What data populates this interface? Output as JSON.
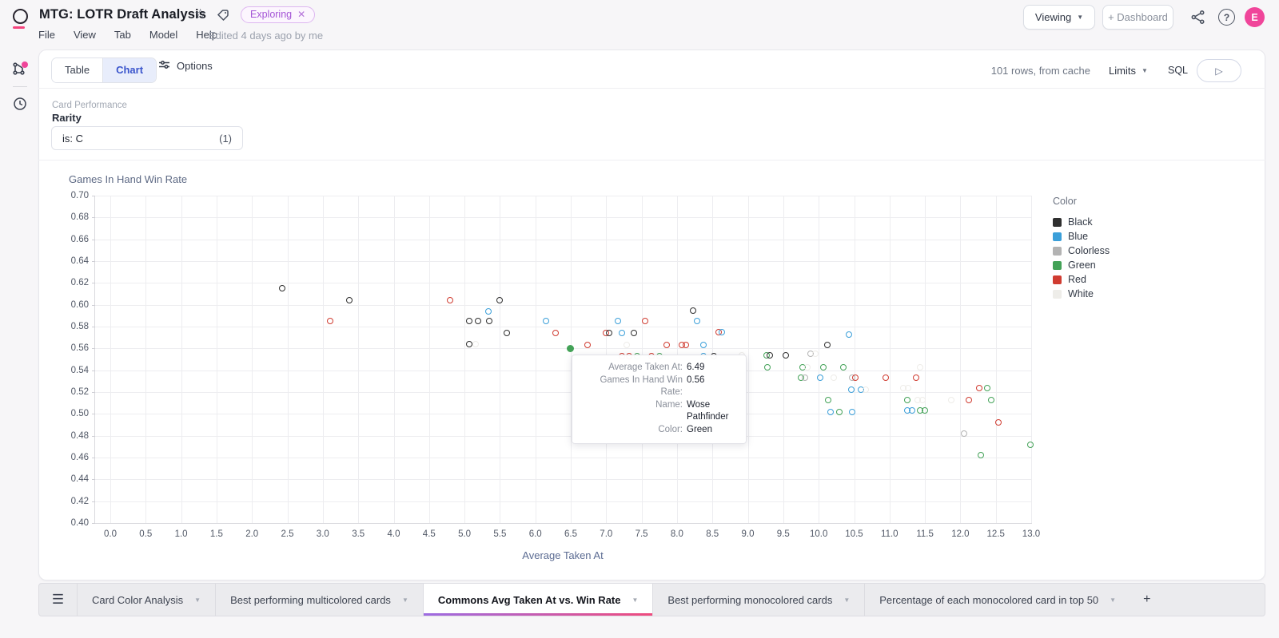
{
  "header": {
    "title": "MTG: LOTR Draft Analysis",
    "badge": "Exploring",
    "badge_close": "✕",
    "menu": [
      "File",
      "View",
      "Tab",
      "Model",
      "Help"
    ],
    "edited": "Edited 4 days ago by me",
    "viewing_button": "Viewing",
    "dashboard_button": "+ Dashboard",
    "avatar_initial": "E",
    "accent_pink": "#f0459a",
    "badge_purple": "#a455d6"
  },
  "toolbar": {
    "table_label": "Table",
    "chart_label": "Chart",
    "options_label": "Options",
    "rows_status": "101 rows, from cache",
    "limits_label": "Limits",
    "sql_label": "SQL",
    "run_glyph": "▷"
  },
  "filter": {
    "section_label": "Card Performance",
    "field_label": "Rarity",
    "value": "is: C",
    "count": "(1)"
  },
  "chart_data": {
    "type": "scatter",
    "xlabel": "Average Taken At",
    "ylabel": "Games In Hand Win Rate",
    "xlim": [
      0,
      13
    ],
    "x_tick_step": 0.5,
    "ylim": [
      0.4,
      0.7
    ],
    "y_tick_step": 0.02,
    "grid": true,
    "legend_position": "right",
    "legend_title": "Color",
    "legend": [
      {
        "label": "Black",
        "color": "#2f2f2f"
      },
      {
        "label": "Blue",
        "color": "#3b9fd9"
      },
      {
        "label": "Colorless",
        "color": "#b3b3b3"
      },
      {
        "label": "Green",
        "color": "#43a257"
      },
      {
        "label": "Red",
        "color": "#d03c31"
      },
      {
        "label": "White",
        "color": "#eeede9"
      }
    ],
    "selected_point": {
      "x": 6.49,
      "y": 0.56,
      "name": "Wose Pathfinder",
      "color": "Green"
    },
    "points": [
      {
        "x": 2.43,
        "y": 0.615,
        "c": "Black"
      },
      {
        "x": 3.37,
        "y": 0.604,
        "c": "Black"
      },
      {
        "x": 3.1,
        "y": 0.585,
        "c": "Red"
      },
      {
        "x": 4.79,
        "y": 0.604,
        "c": "Red"
      },
      {
        "x": 5.34,
        "y": 0.594,
        "c": "Blue"
      },
      {
        "x": 5.49,
        "y": 0.604,
        "c": "Black"
      },
      {
        "x": 5.07,
        "y": 0.585,
        "c": "Black"
      },
      {
        "x": 5.19,
        "y": 0.585,
        "c": "Black"
      },
      {
        "x": 5.35,
        "y": 0.585,
        "c": "Black"
      },
      {
        "x": 5.6,
        "y": 0.574,
        "c": "Black"
      },
      {
        "x": 5.07,
        "y": 0.564,
        "c": "Black"
      },
      {
        "x": 5.16,
        "y": 0.564,
        "c": "White"
      },
      {
        "x": 6.15,
        "y": 0.585,
        "c": "Blue"
      },
      {
        "x": 6.28,
        "y": 0.574,
        "c": "Red"
      },
      {
        "x": 6.49,
        "y": 0.56,
        "c": "Green",
        "selected": true
      },
      {
        "x": 6.74,
        "y": 0.563,
        "c": "Red"
      },
      {
        "x": 7.0,
        "y": 0.574,
        "c": "Red"
      },
      {
        "x": 7.04,
        "y": 0.574,
        "c": "Black"
      },
      {
        "x": 7.17,
        "y": 0.585,
        "c": "Blue"
      },
      {
        "x": 7.22,
        "y": 0.574,
        "c": "Blue"
      },
      {
        "x": 7.39,
        "y": 0.574,
        "c": "Black"
      },
      {
        "x": 7.55,
        "y": 0.585,
        "c": "Red"
      },
      {
        "x": 7.29,
        "y": 0.563,
        "c": "White"
      },
      {
        "x": 7.22,
        "y": 0.553,
        "c": "Red"
      },
      {
        "x": 7.32,
        "y": 0.553,
        "c": "Red"
      },
      {
        "x": 7.44,
        "y": 0.553,
        "c": "Green"
      },
      {
        "x": 7.64,
        "y": 0.553,
        "c": "Red"
      },
      {
        "x": 7.75,
        "y": 0.553,
        "c": "Green"
      },
      {
        "x": 7.85,
        "y": 0.563,
        "c": "Red"
      },
      {
        "x": 8.07,
        "y": 0.563,
        "c": "Red"
      },
      {
        "x": 8.13,
        "y": 0.563,
        "c": "Red"
      },
      {
        "x": 8.37,
        "y": 0.563,
        "c": "Blue"
      },
      {
        "x": 8.23,
        "y": 0.595,
        "c": "Black"
      },
      {
        "x": 8.28,
        "y": 0.585,
        "c": "Blue"
      },
      {
        "x": 8.59,
        "y": 0.575,
        "c": "Red"
      },
      {
        "x": 8.63,
        "y": 0.575,
        "c": "Blue"
      },
      {
        "x": 8.37,
        "y": 0.553,
        "c": "Blue"
      },
      {
        "x": 8.52,
        "y": 0.553,
        "c": "Black"
      },
      {
        "x": 8.92,
        "y": 0.554,
        "c": "White"
      },
      {
        "x": 9.26,
        "y": 0.554,
        "c": "Green"
      },
      {
        "x": 9.31,
        "y": 0.554,
        "c": "Black"
      },
      {
        "x": 9.53,
        "y": 0.554,
        "c": "Black"
      },
      {
        "x": 9.88,
        "y": 0.555,
        "c": "Colorless"
      },
      {
        "x": 9.95,
        "y": 0.555,
        "c": "White"
      },
      {
        "x": 10.12,
        "y": 0.563,
        "c": "Black"
      },
      {
        "x": 10.43,
        "y": 0.573,
        "c": "Blue"
      },
      {
        "x": 9.27,
        "y": 0.543,
        "c": "Green"
      },
      {
        "x": 9.77,
        "y": 0.543,
        "c": "Green"
      },
      {
        "x": 9.84,
        "y": 0.543,
        "c": "White"
      },
      {
        "x": 10.07,
        "y": 0.543,
        "c": "Green"
      },
      {
        "x": 10.35,
        "y": 0.543,
        "c": "Green"
      },
      {
        "x": 9.75,
        "y": 0.533,
        "c": "Green"
      },
      {
        "x": 9.81,
        "y": 0.533,
        "c": "Colorless"
      },
      {
        "x": 10.02,
        "y": 0.533,
        "c": "Blue"
      },
      {
        "x": 10.21,
        "y": 0.533,
        "c": "White"
      },
      {
        "x": 10.47,
        "y": 0.533,
        "c": "Colorless"
      },
      {
        "x": 10.52,
        "y": 0.533,
        "c": "Red"
      },
      {
        "x": 10.95,
        "y": 0.533,
        "c": "Red"
      },
      {
        "x": 11.38,
        "y": 0.533,
        "c": "Red"
      },
      {
        "x": 10.46,
        "y": 0.522,
        "c": "Blue"
      },
      {
        "x": 10.6,
        "y": 0.522,
        "c": "Blue"
      },
      {
        "x": 10.66,
        "y": 0.522,
        "c": "White"
      },
      {
        "x": 11.43,
        "y": 0.543,
        "c": "White"
      },
      {
        "x": 11.19,
        "y": 0.524,
        "c": "White"
      },
      {
        "x": 11.26,
        "y": 0.524,
        "c": "White"
      },
      {
        "x": 12.27,
        "y": 0.524,
        "c": "Red"
      },
      {
        "x": 12.38,
        "y": 0.524,
        "c": "Green"
      },
      {
        "x": 10.13,
        "y": 0.513,
        "c": "Green"
      },
      {
        "x": 11.25,
        "y": 0.513,
        "c": "Green"
      },
      {
        "x": 11.4,
        "y": 0.513,
        "c": "White"
      },
      {
        "x": 11.47,
        "y": 0.513,
        "c": "White"
      },
      {
        "x": 11.87,
        "y": 0.513,
        "c": "White"
      },
      {
        "x": 12.12,
        "y": 0.513,
        "c": "Red"
      },
      {
        "x": 12.44,
        "y": 0.513,
        "c": "Green"
      },
      {
        "x": 10.17,
        "y": 0.502,
        "c": "Blue"
      },
      {
        "x": 10.29,
        "y": 0.502,
        "c": "Green"
      },
      {
        "x": 10.47,
        "y": 0.502,
        "c": "Blue"
      },
      {
        "x": 11.25,
        "y": 0.503,
        "c": "Blue"
      },
      {
        "x": 11.32,
        "y": 0.503,
        "c": "Blue"
      },
      {
        "x": 11.43,
        "y": 0.503,
        "c": "Green"
      },
      {
        "x": 11.5,
        "y": 0.503,
        "c": "Green"
      },
      {
        "x": 12.54,
        "y": 0.492,
        "c": "Red"
      },
      {
        "x": 12.05,
        "y": 0.482,
        "c": "Colorless"
      },
      {
        "x": 12.99,
        "y": 0.472,
        "c": "Green"
      },
      {
        "x": 12.29,
        "y": 0.462,
        "c": "Green"
      }
    ]
  },
  "tooltip": {
    "rows": [
      {
        "label": "Average Taken At:",
        "value": "6.49"
      },
      {
        "label": "Games In Hand Win Rate:",
        "value": "0.56"
      },
      {
        "label": "Name:",
        "value": "Wose Pathfinder"
      },
      {
        "label": "Color:",
        "value": "Green"
      }
    ]
  },
  "footer": {
    "tabs": [
      {
        "label": "Card Color Analysis",
        "active": false
      },
      {
        "label": "Best performing multicolored cards",
        "active": false
      },
      {
        "label": "Commons Avg Taken At vs. Win Rate",
        "active": true
      },
      {
        "label": "Best performing monocolored cards",
        "active": false
      },
      {
        "label": "Percentage of each monocolored card in top 50",
        "active": false
      }
    ],
    "add_tab_label": "+"
  }
}
